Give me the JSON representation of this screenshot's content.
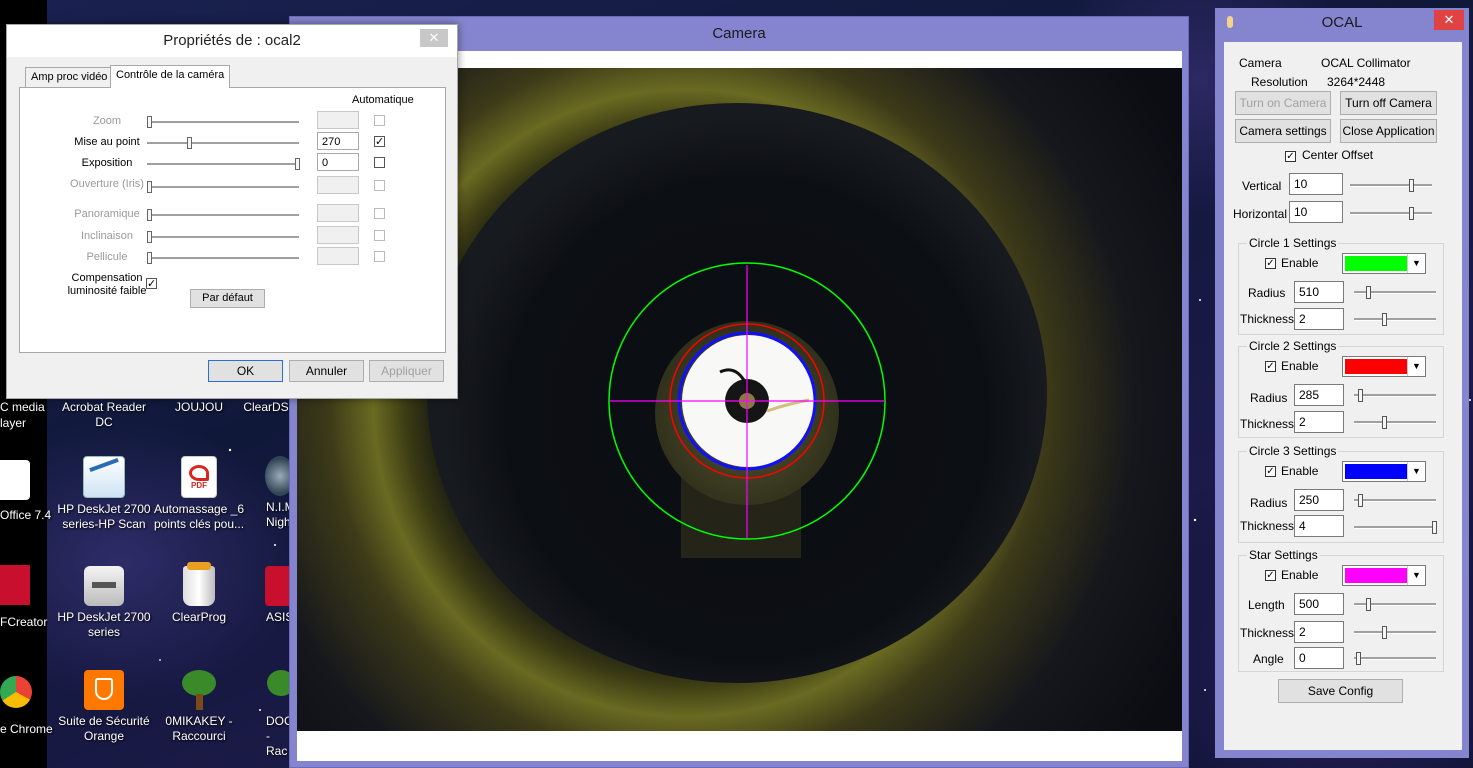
{
  "desktop": {
    "edge_labels": [
      "C media",
      "layer",
      "Office 7.4",
      "FCreator",
      "e Chrome"
    ],
    "icons": [
      {
        "label": "Acrobat Reader DC",
        "icon": "acrobat-icon"
      },
      {
        "label": "JOUJOU",
        "icon": "folder-icon"
      },
      {
        "label": "ClearDS",
        "icon": "app-icon"
      },
      {
        "label": "HP DeskJet 2700 series-HP Scan",
        "icon": "scanner-icon"
      },
      {
        "label": "Automassage _6 points clés pou...",
        "icon": "pdf-icon"
      },
      {
        "label": "N.I.M Nigh",
        "icon": "app-icon"
      },
      {
        "label": "HP DeskJet 2700 series",
        "icon": "printer-icon"
      },
      {
        "label": "ClearProg",
        "icon": "trash-icon"
      },
      {
        "label": "ASIS",
        "icon": "app-icon"
      },
      {
        "label": "Suite de Sécurité Orange",
        "icon": "shield-icon"
      },
      {
        "label": "0MIKAKEY - Raccourci",
        "icon": "tree-icon"
      },
      {
        "label": "DOCS_ - Rac",
        "icon": "tree-icon"
      }
    ]
  },
  "camera_window": {
    "title": "Camera"
  },
  "properties_dialog": {
    "title": "Propriétés de : ocal2",
    "close_glyph": "✕",
    "tabs": [
      "Amp proc vidéo",
      "Contrôle de la caméra"
    ],
    "auto_header": "Automatique",
    "controls": [
      {
        "label": "Zoom",
        "value": "",
        "checked": false,
        "enabled": false,
        "level": 0.0
      },
      {
        "label": "Mise au point",
        "value": "270",
        "checked": true,
        "enabled": true,
        "level": 0.27
      },
      {
        "label": "Exposition",
        "value": "0",
        "checked": false,
        "enabled": true,
        "level": 1.0
      },
      {
        "label": "Ouverture (Iris)",
        "value": "",
        "checked": false,
        "enabled": false,
        "level": 0.0
      },
      {
        "label": "Panoramique",
        "value": "",
        "checked": false,
        "enabled": false,
        "level": 0.0
      },
      {
        "label": "Inclinaison",
        "value": "",
        "checked": false,
        "enabled": false,
        "level": 0.0
      },
      {
        "label": "Pellicule",
        "value": "",
        "checked": false,
        "enabled": false,
        "level": 0.0
      }
    ],
    "low_light_label": "Compensation luminosité faible",
    "low_light_checked": true,
    "default_button": "Par défaut",
    "ok_button": "OK",
    "cancel_button": "Annuler",
    "apply_button": "Appliquer"
  },
  "ocal": {
    "title": "OCAL",
    "close_glyph": "✕",
    "camera_label": "Camera",
    "camera_value": "OCAL Collimator",
    "resolution_label": "Resolution",
    "resolution_value": "3264*2448",
    "turn_on": "Turn on Camera",
    "turn_off": "Turn off Camera",
    "camera_settings": "Camera settings",
    "close_app": "Close Application",
    "center_offset_label": "Center Offset",
    "center_offset_checked": true,
    "vertical_label": "Vertical",
    "vertical_value": "10",
    "horizontal_label": "Horizontal",
    "horizontal_value": "10",
    "enable_label": "Enable",
    "circle1": {
      "title": "Circle 1 Settings",
      "color": "#00ff00",
      "radius_label": "Radius",
      "radius": "510",
      "thickness_label": "Thickness",
      "thickness": "2"
    },
    "circle2": {
      "title": "Circle 2 Settings",
      "color": "#ff0000",
      "radius_label": "Radius",
      "radius": "285",
      "thickness_label": "Thickness",
      "thickness": "2"
    },
    "circle3": {
      "title": "Circle 3 Settings",
      "color": "#0000ff",
      "radius_label": "Radius",
      "radius": "250",
      "thickness_label": "Thickness",
      "thickness": "4"
    },
    "star": {
      "title": "Star Settings",
      "color": "#ff00ff",
      "length_label": "Length",
      "length": "500",
      "thickness_label": "Thickness",
      "thickness": "2",
      "angle_label": "Angle",
      "angle": "0"
    },
    "save_config": "Save Config"
  }
}
